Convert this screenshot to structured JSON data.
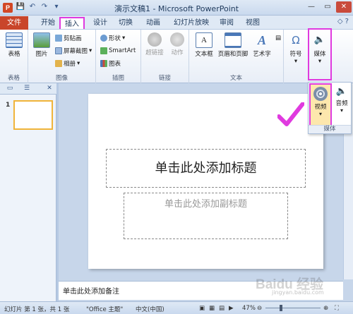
{
  "window": {
    "app_icon": "P",
    "title": "演示文稿1 - Microsoft PowerPoint",
    "controls": [
      "—",
      "▭",
      "✕"
    ]
  },
  "qat": {
    "save_icon": "save-icon",
    "undo_icon": "undo-icon",
    "redo_icon": "redo-icon",
    "customize_icon": "customize-qat-icon"
  },
  "tabs": [
    {
      "label": "文件"
    },
    {
      "label": "开始"
    },
    {
      "label": "插入"
    },
    {
      "label": "设计"
    },
    {
      "label": "切换"
    },
    {
      "label": "动画"
    },
    {
      "label": "幻灯片放映"
    },
    {
      "label": "审阅"
    },
    {
      "label": "视图"
    }
  ],
  "ribbon": {
    "table": {
      "label": "表格",
      "group": "表格"
    },
    "images": {
      "picture": "图片",
      "clipart": "剪贴画",
      "screenshot": "屏幕截图",
      "album": "相册",
      "group": "图像"
    },
    "illustrations": {
      "shapes": "形状",
      "smartart": "SmartArt",
      "chart": "图表",
      "group": "插图"
    },
    "links": {
      "hyperlink": "超链接",
      "action": "动作",
      "group": "链接"
    },
    "text": {
      "textbox": "文本框",
      "header_footer": "页眉和页脚",
      "wordart": "艺术字",
      "group": "文本"
    },
    "symbols": {
      "label": "符号"
    },
    "media": {
      "label": "媒体"
    }
  },
  "media_dropdown": {
    "video": "视频",
    "audio": "音频",
    "footer": "媒体"
  },
  "slide_pane": {
    "slide_number": "1"
  },
  "slide": {
    "title_placeholder": "单击此处添加标题",
    "subtitle_placeholder": "单击此处添加副标题"
  },
  "notes": {
    "placeholder": "单击此处添加备注"
  },
  "status": {
    "slide_info": "幻灯片 第 1 张，共 1 张",
    "theme": "\"Office 主题\"",
    "language": "中文(中国)",
    "zoom": "47%"
  },
  "watermark": {
    "text": "Baidu 经验",
    "url": "jingyan.baidu.com"
  },
  "colors": {
    "highlight": "#e03adf",
    "file_tab": "#c9452a",
    "accent": "#1e395b"
  }
}
